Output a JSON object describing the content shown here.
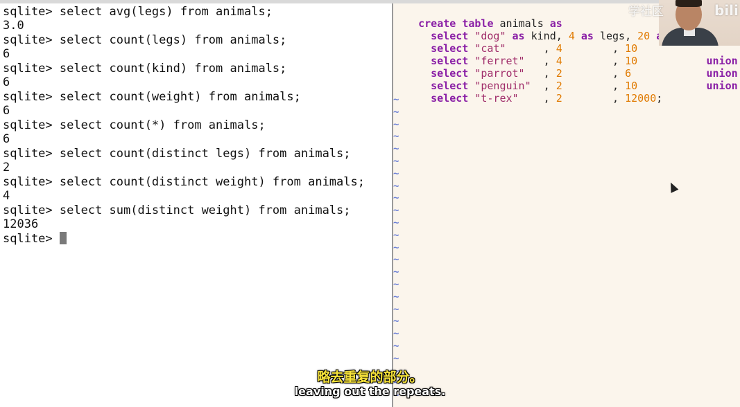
{
  "terminal": {
    "lines": [
      "sqlite> select avg(legs) from animals;",
      "3.0",
      "sqlite> select count(legs) from animals;",
      "6",
      "sqlite> select count(kind) from animals;",
      "6",
      "sqlite> select count(weight) from animals;",
      "6",
      "sqlite> select count(*) from animals;",
      "6",
      "sqlite> select count(distinct legs) from animals;",
      "2",
      "sqlite> select count(distinct weight) from animals;",
      "4",
      "sqlite> select sum(distinct weight) from animals;",
      "12036"
    ],
    "prompt": "sqlite> "
  },
  "editor": {
    "line1": {
      "kw1": "create",
      "t1": " ",
      "kw2": "table",
      "t2": " animals ",
      "kw3": "as"
    },
    "rows": [
      {
        "sel": "select",
        "name": "\"dog\"",
        "mid1": " as kind, ",
        "legs": "4",
        "mid2": " as legs, ",
        "weight": "20",
        "mid3": " as we",
        "tail": ""
      },
      {
        "sel": "select",
        "name": "\"cat\"",
        "mid1": "      , ",
        "legs": "4",
        "mid2": "        , ",
        "weight": "10",
        "mid3": "",
        "tail": ""
      },
      {
        "sel": "select",
        "name": "\"ferret\"",
        "mid1": "   , ",
        "legs": "4",
        "mid2": "        , ",
        "weight": "10",
        "mid3": "           ",
        "tail": "union"
      },
      {
        "sel": "select",
        "name": "\"parrot\"",
        "mid1": "   , ",
        "legs": "2",
        "mid2": "        , ",
        "weight": "6",
        "mid3": "            ",
        "tail": "union"
      },
      {
        "sel": "select",
        "name": "\"penguin\"",
        "mid1": "  , ",
        "legs": "2",
        "mid2": "        , ",
        "weight": "10",
        "mid3": "           ",
        "tail": "union"
      },
      {
        "sel": "select",
        "name": "\"t-rex\"",
        "mid1": "    , ",
        "legs": "2",
        "mid2": "        , ",
        "weight": "12000",
        "mid3": ";",
        "tail": ""
      }
    ],
    "tilde": "~"
  },
  "overlay": {
    "watermark": "学社区",
    "logo": "bili",
    "subtitle_cn": "略去重复的部分。",
    "subtitle_en": "leaving out the repeats."
  },
  "colors": {
    "keyword": "#8a1fa6",
    "string": "#a02d6a",
    "number": "#e07a00",
    "tilde": "#6b7fd6",
    "editor_bg": "#fbf5ec"
  }
}
